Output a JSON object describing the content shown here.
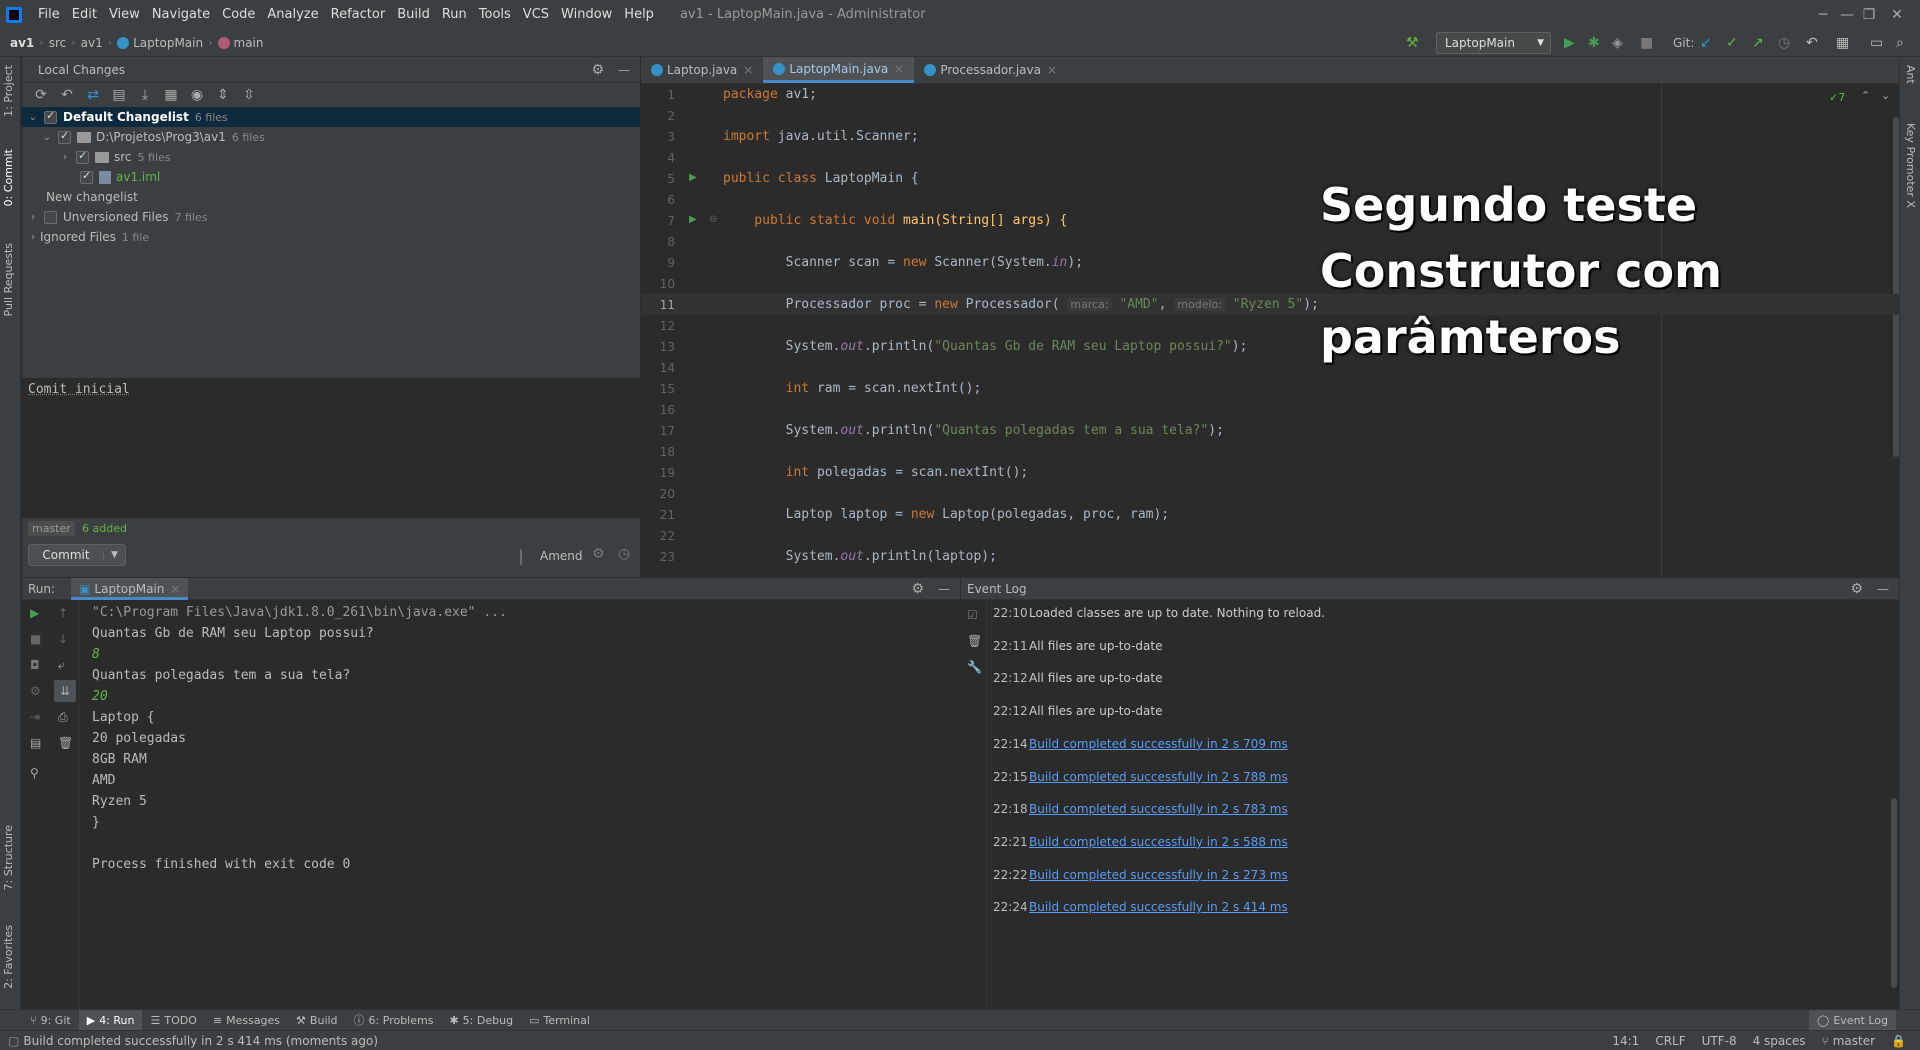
{
  "menubar": {
    "items": [
      "File",
      "Edit",
      "View",
      "Navigate",
      "Code",
      "Analyze",
      "Refactor",
      "Build",
      "Run",
      "Tools",
      "VCS",
      "Window",
      "Help"
    ],
    "window_title": "av1 - LaptopMain.java - Administrator"
  },
  "navbar": {
    "crumbs": [
      "av1",
      "src",
      "av1",
      "LaptopMain",
      "main"
    ],
    "run_config": "LaptopMain",
    "git_label": "Git:"
  },
  "left_strip": {
    "tabs": [
      "1: Project",
      "0: Commit",
      "Pull Requests",
      "7: Structure",
      "2: Favorites"
    ]
  },
  "right_strip": {
    "tabs": [
      "Ant",
      "Key Promoter X"
    ]
  },
  "local_changes": {
    "title": "Local Changes",
    "tree": [
      {
        "label": "Default Changelist",
        "count": "6 files"
      },
      {
        "label": "D:\\Projetos\\Prog3\\av1",
        "count": "6 files"
      },
      {
        "label": "src",
        "count": "5 files"
      },
      {
        "label": "av1.iml",
        "count": ""
      },
      {
        "label": "New changelist",
        "count": ""
      },
      {
        "label": "Unversioned Files",
        "count": "7 files"
      },
      {
        "label": "Ignored Files",
        "count": "1 file"
      }
    ],
    "commit_message": "Comit inicial",
    "branch": "master",
    "added": "6 added",
    "commit_button": "Commit",
    "amend_label": "Amend"
  },
  "editor": {
    "tabs": [
      "Laptop.java",
      "LaptopMain.java",
      "Processador.java"
    ],
    "inspection_count": "7",
    "code": {
      "l1a": "package ",
      "l1b": "av1;",
      "l3a": "import ",
      "l3b": "java.util.Scanner;",
      "l5a": "public class ",
      "l5b": "LaptopMain {",
      "l7a": "    public static void ",
      "l7b": "main(String[] args) {",
      "l9a": "        Scanner scan = ",
      "l9b": "new ",
      "l9c": "Scanner(System.",
      "l9d": "in",
      "l9e": ");",
      "l11a": "        Processador proc = ",
      "l11b": "new ",
      "l11c": "Processador( ",
      "l11h1": "marca:",
      "l11s1": " \"AMD\"",
      "l11c2": ", ",
      "l11h2": "modelo:",
      "l11s2": " \"Ryzen 5\"",
      "l11e": ");",
      "l13a": "        System.",
      "l13b": "out",
      "l13c": ".println(",
      "l13s": "\"Quantas Gb de RAM seu Laptop possui?\"",
      "l13e": ");",
      "l15a": "        ",
      "l15k": "int ",
      "l15b": "ram = scan.nextInt();",
      "l17a": "        System.",
      "l17b": "out",
      "l17c": ".println(",
      "l17s": "\"Quantas polegadas tem a sua tela?\"",
      "l17e": ");",
      "l19a": "        ",
      "l19k": "int ",
      "l19b": "polegadas = scan.nextInt();",
      "l21a": "        Laptop laptop = ",
      "l21k": "new ",
      "l21b": "Laptop(polegadas, proc, ram);",
      "l23a": "        System.",
      "l23b": "out",
      "l23c": ".println(laptop);"
    },
    "line_numbers": [
      "1",
      "2",
      "3",
      "4",
      "5",
      "6",
      "7",
      "8",
      "9",
      "10",
      "11",
      "12",
      "13",
      "14",
      "15",
      "16",
      "17",
      "18",
      "19",
      "20",
      "21",
      "22",
      "23"
    ]
  },
  "overlay": {
    "line1": "Segundo teste",
    "line2": "Construtor com",
    "line3": "parâmteros"
  },
  "run": {
    "label": "Run:",
    "tab": "LaptopMain",
    "output": [
      {
        "text": "\"C:\\Program Files\\Java\\jdk1.8.0_261\\bin\\java.exe\" ...",
        "kind": "cmd"
      },
      {
        "text": "Quantas Gb de RAM seu Laptop possui?",
        "kind": "out"
      },
      {
        "text": "8",
        "kind": "in"
      },
      {
        "text": "Quantas polegadas tem a sua tela?",
        "kind": "out"
      },
      {
        "text": "20",
        "kind": "in"
      },
      {
        "text": "Laptop {",
        "kind": "out"
      },
      {
        "text": "20 polegadas",
        "kind": "out"
      },
      {
        "text": "8GB RAM",
        "kind": "out"
      },
      {
        "text": "AMD",
        "kind": "out"
      },
      {
        "text": "Ryzen 5",
        "kind": "out"
      },
      {
        "text": "}",
        "kind": "out"
      },
      {
        "text": "",
        "kind": "out"
      },
      {
        "text": "Process finished with exit code 0",
        "kind": "out"
      }
    ]
  },
  "event_log": {
    "title": "Event Log",
    "entries": [
      {
        "time": "22:10",
        "msg": "Loaded classes are up to date. Nothing to reload.",
        "link": false
      },
      {
        "time": "22:11",
        "msg": "All files are up-to-date",
        "link": false
      },
      {
        "time": "22:12",
        "msg": "All files are up-to-date",
        "link": false
      },
      {
        "time": "22:12",
        "msg": "All files are up-to-date",
        "link": false
      },
      {
        "time": "22:14",
        "msg": "Build completed successfully in 2 s 709 ms",
        "link": true
      },
      {
        "time": "22:15",
        "msg": "Build completed successfully in 2 s 788 ms",
        "link": true
      },
      {
        "time": "22:18",
        "msg": "Build completed successfully in 2 s 783 ms",
        "link": true
      },
      {
        "time": "22:21",
        "msg": "Build completed successfully in 2 s 588 ms",
        "link": true
      },
      {
        "time": "22:22",
        "msg": "Build completed successfully in 2 s 273 ms",
        "link": true
      },
      {
        "time": "22:24",
        "msg": "Build completed successfully in 2 s 414 ms",
        "link": true
      }
    ]
  },
  "bottom_tabs": [
    "9: Git",
    "4: Run",
    "TODO",
    "Messages",
    "Build",
    "6: Problems",
    "5: Debug",
    "Terminal"
  ],
  "event_log_button": "Event Log",
  "status": {
    "message": "Build completed successfully in 2 s 414 ms (moments ago)",
    "position": "14:1",
    "line_sep": "CRLF",
    "encoding": "UTF-8",
    "indent": "4 spaces",
    "branch": "master"
  }
}
